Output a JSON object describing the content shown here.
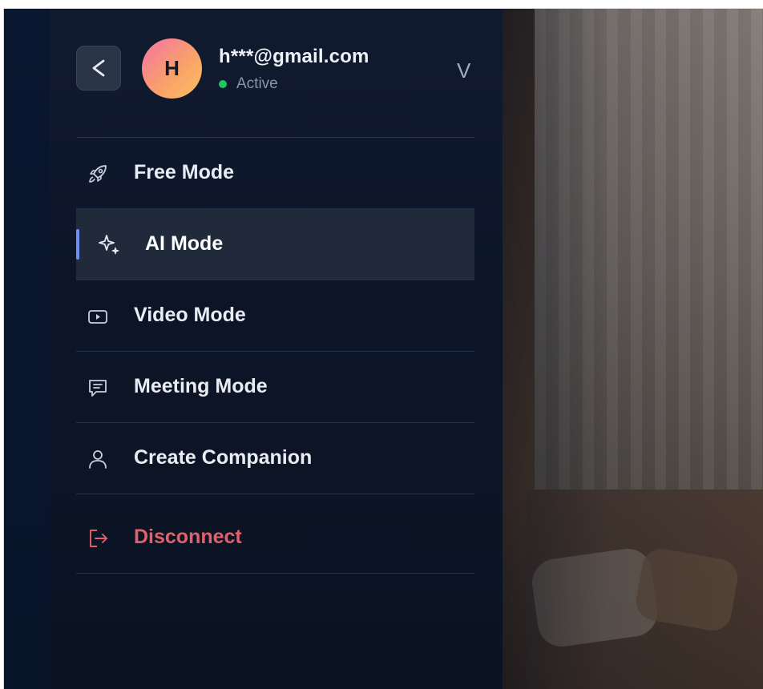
{
  "account": {
    "avatar_initial": "H",
    "email": "h***@gmail.com",
    "status": "Active",
    "status_color": "#22c55e",
    "back_glyph": "<",
    "expand_glyph": "V"
  },
  "menu": {
    "items": [
      {
        "label": "Free Mode",
        "icon": "rocket-icon",
        "active": false
      },
      {
        "label": "AI Mode",
        "icon": "sparkles-icon",
        "active": true
      },
      {
        "label": "Video Mode",
        "icon": "video-icon",
        "active": false
      },
      {
        "label": "Meeting Mode",
        "icon": "chat-icon",
        "active": false
      },
      {
        "label": "Create Companion",
        "icon": "user-icon",
        "active": false
      },
      {
        "label": "Disconnect",
        "icon": "logout-icon",
        "active": false,
        "danger": true
      }
    ]
  },
  "colors": {
    "panel_bg": "#0c1528",
    "active_item_bg": "#202a3b",
    "active_accent": "#6c8ef5",
    "danger": "#e0616b"
  }
}
